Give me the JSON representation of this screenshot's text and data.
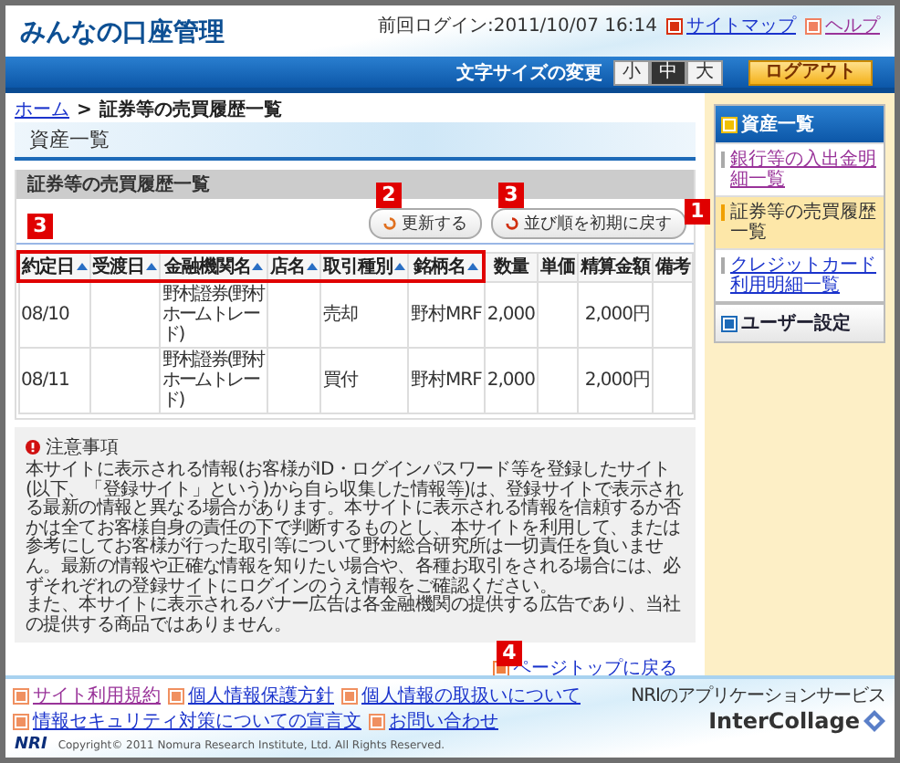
{
  "header": {
    "title": "みんなの口座管理",
    "last_login": "前回ログイン:2011/10/07 16:14",
    "links": [
      {
        "label": "サイトマップ"
      },
      {
        "label": "ヘルプ"
      }
    ],
    "font_size_label": "文字サイズの変更",
    "font_sizes": [
      {
        "label": "小",
        "selected": false
      },
      {
        "label": "中",
        "selected": true
      },
      {
        "label": "大",
        "selected": false
      }
    ],
    "logout": "ログアウト"
  },
  "breadcrumb": [
    {
      "label": "ホーム",
      "link": true
    },
    {
      "label": ">",
      "link": false
    },
    {
      "label": "証券等の売買履歴一覧",
      "link": false
    }
  ],
  "section_title": "資産一覧",
  "panel": {
    "title": "証券等の売買履歴一覧",
    "buttons": [
      {
        "label": "更新する",
        "annotation": "2"
      },
      {
        "label": "並び順を初期に戻す",
        "annotation": "3"
      }
    ],
    "table": {
      "annotation": "3",
      "columns": [
        {
          "label": "約定日",
          "sortable": true,
          "highlighted": true
        },
        {
          "label": "受渡日",
          "sortable": true,
          "highlighted": true
        },
        {
          "label": "金融機関名",
          "sortable": true,
          "highlighted": true
        },
        {
          "label": "店名",
          "sortable": true,
          "highlighted": true
        },
        {
          "label": "取引種別",
          "sortable": true,
          "highlighted": true
        },
        {
          "label": "銘柄名",
          "sortable": true,
          "highlighted": true
        },
        {
          "label": "数量",
          "sortable": false,
          "highlighted": false
        },
        {
          "label": "単価",
          "sortable": false,
          "highlighted": false
        },
        {
          "label": "精算金額",
          "sortable": false,
          "highlighted": false
        },
        {
          "label": "備考",
          "sortable": false,
          "highlighted": false
        }
      ],
      "rows": [
        [
          "08/10",
          null,
          "野村證券(野村ホームトレード)",
          null,
          "売却",
          "野村MRF",
          "2,000",
          null,
          "2,000円",
          null
        ],
        [
          "08/11",
          null,
          "野村證券(野村ホームトレード)",
          null,
          "買付",
          "野村MRF",
          "2,000",
          null,
          "2,000円",
          null
        ]
      ]
    }
  },
  "notes": {
    "title": "注意事項",
    "paragraphs": [
      "本サイトに表示される情報(お客様がID・ログインパスワード等を登録したサイト(以下、「登録サイト」という)から自ら収集した情報等)は、登録サイトで表示される最新の情報と異なる場合があります。本サイトに表示される情報を信頼するか否かは全てお客様自身の責任の下で判断するものとし、本サイトを利用して、または参考にしてお客様が行った取引等について野村総合研究所は一切責任を負いません。最新の情報や正確な情報を知りたい場合や、各種お取引をされる場合には、必ずそれぞれの登録サイトにログインのうえ情報をご確認ください。",
      "また、本サイトに表示されるバナー広告は各金融機関の提供する広告であり、当社の提供する商品ではありません。"
    ]
  },
  "page_top": {
    "label": "ページトップに戻る",
    "annotation": "4"
  },
  "sidebar": {
    "sections": [
      {
        "title": "資産一覧",
        "active": true,
        "items": [
          {
            "label": "銀行等の入出金明細一覧",
            "selected": false,
            "visited": true
          },
          {
            "label": "証券等の売買履歴一覧",
            "selected": true,
            "visited": false,
            "annotation": "1"
          },
          {
            "label": "クレジットカード利用明細一覧",
            "selected": false,
            "visited": false
          }
        ]
      },
      {
        "title": "ユーザー設定",
        "active": false
      }
    ]
  },
  "footer": {
    "links": [
      {
        "label": "サイト利用規約",
        "visited": true
      },
      {
        "label": "個人情報保護方針",
        "visited": false
      },
      {
        "label": "個人情報の取扱いについて",
        "visited": false
      },
      {
        "label": "情報セキュリティ対策についての宣言文",
        "visited": false
      },
      {
        "label": "お問い合わせ",
        "visited": false
      }
    ],
    "company_logo": "NRI",
    "copyright": "Copyright© 2011 Nomura Research Institute, Ltd. All Rights Reserved.",
    "service_tagline": "NRIのアプリケーションサービス",
    "service_logo": "InterCollage"
  }
}
